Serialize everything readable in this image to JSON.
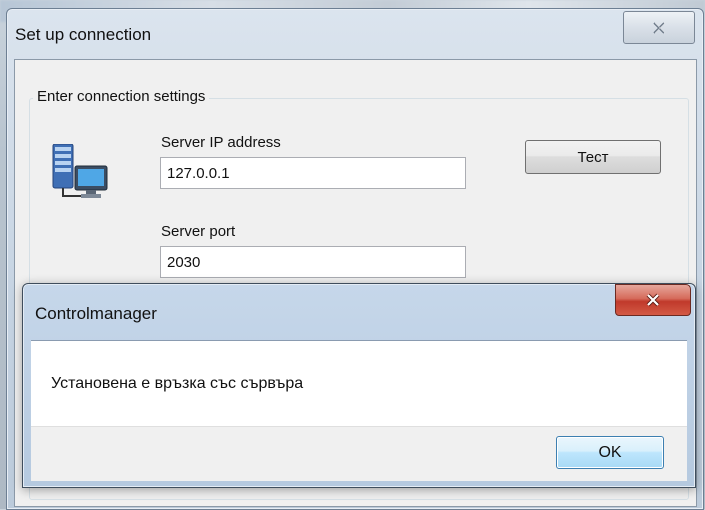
{
  "setup_window": {
    "title": "Set up connection",
    "close_icon": "close-icon",
    "group_label": "Enter connection settings",
    "server_ip": {
      "label": "Server IP address",
      "value": "127.0.0.1"
    },
    "server_port": {
      "label": "Server port",
      "value": "2030"
    },
    "test_button": "Тест",
    "icon": "server-computer-icon"
  },
  "message_box": {
    "title": "Controlmanager",
    "close_icon": "close-icon",
    "message": "Установена е връзка със сървъра",
    "ok_button": "OK"
  }
}
